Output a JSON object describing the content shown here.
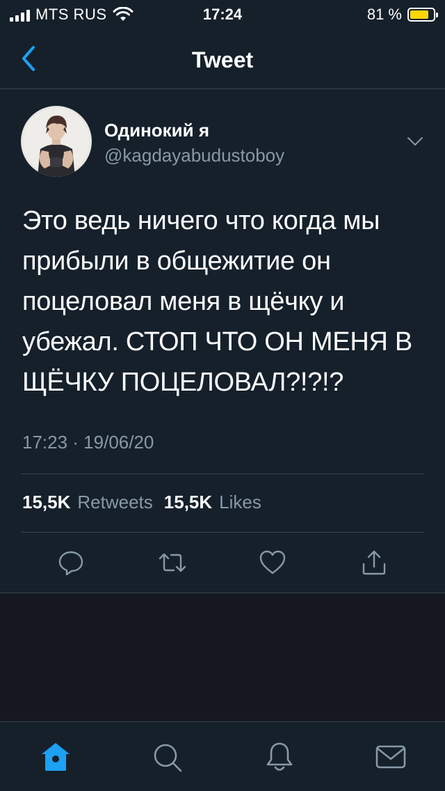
{
  "status_bar": {
    "carrier": "MTS RUS",
    "time": "17:24",
    "battery_percent": "81 %",
    "battery_level": 0.81
  },
  "nav": {
    "title": "Tweet",
    "back_icon": "chevron-left-icon"
  },
  "tweet": {
    "author_name": "Одинокий я",
    "author_handle": "@kagdayabudustoboy",
    "text": "Это ведь ничего что когда мы прибыли в общежитие он поцеловал меня в щёчку и убежал. СТОП ЧТО ОН МЕНЯ В ЩЁЧКУ ПОЦЕЛОВАЛ?!?!?",
    "timestamp": "17:23 · 19/06/20",
    "retweets_count": "15,5K",
    "retweets_label": "Retweets",
    "likes_count": "15,5K",
    "likes_label": "Likes",
    "actions": [
      "reply-icon",
      "retweet-icon",
      "like-icon",
      "share-icon"
    ]
  },
  "tab_bar": {
    "tabs": [
      "home-icon",
      "search-icon",
      "notifications-icon",
      "messages-icon"
    ],
    "active": "home-icon"
  },
  "colors": {
    "accent": "#1da1f2",
    "background": "#15202b",
    "secondary_text": "#8899a6",
    "battery": "#ffd60a"
  }
}
